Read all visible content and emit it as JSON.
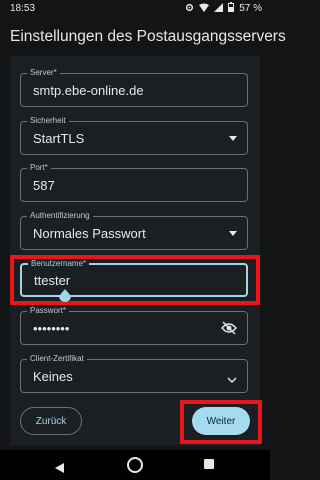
{
  "status_bar": {
    "time": "18:53",
    "battery": "57 %",
    "icons": [
      "gear-icon",
      "wifi-icon",
      "signal-icon",
      "battery-icon"
    ]
  },
  "screen_title": "Einstellungen des Postausgangsservers",
  "fields": {
    "server": {
      "label": "Server*",
      "value": "smtp.ebe-online.de"
    },
    "security": {
      "label": "Sicherheit",
      "value": "StartTLS"
    },
    "port": {
      "label": "Port*",
      "value": "587"
    },
    "authentication": {
      "label": "Authentifizierung",
      "value": "Normales Passwort"
    },
    "username": {
      "label": "Benutzername*",
      "value": "ttester"
    },
    "password": {
      "label": "Passwort*",
      "value": "••••••••"
    },
    "client_certificate": {
      "label": "Client-Zertifikat",
      "value": "Keines"
    }
  },
  "buttons": {
    "back": "Zurück",
    "next": "Weiter"
  },
  "colors": {
    "background": "#121416",
    "accent": "#9fd6ec",
    "highlight": "#e8151c",
    "next_button": "#a6dbef"
  }
}
